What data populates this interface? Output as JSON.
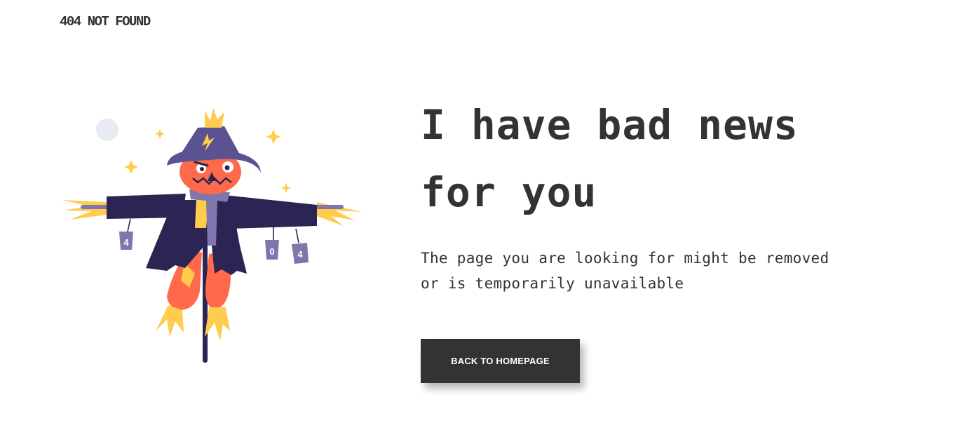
{
  "header": {
    "brand": "404 NOT FOUND"
  },
  "main": {
    "headline_line1": "I have bad news",
    "headline_line2": "for you",
    "message_line1": "The page you are looking for might be removed",
    "message_line2": "or is temporarily unavailable",
    "button_label": "BACK TO HOMEPAGE"
  },
  "illustration": {
    "subject": "scarecrow",
    "can_labels": [
      "4",
      "0",
      "4"
    ],
    "colors": {
      "text": "#333333",
      "hat": "#5b5391",
      "coat": "#2c2452",
      "face": "#ff6b4a",
      "straw": "#ffcc4d",
      "can": "#7e76ad",
      "moon": "#e8ebf4",
      "button": "#333333"
    }
  }
}
